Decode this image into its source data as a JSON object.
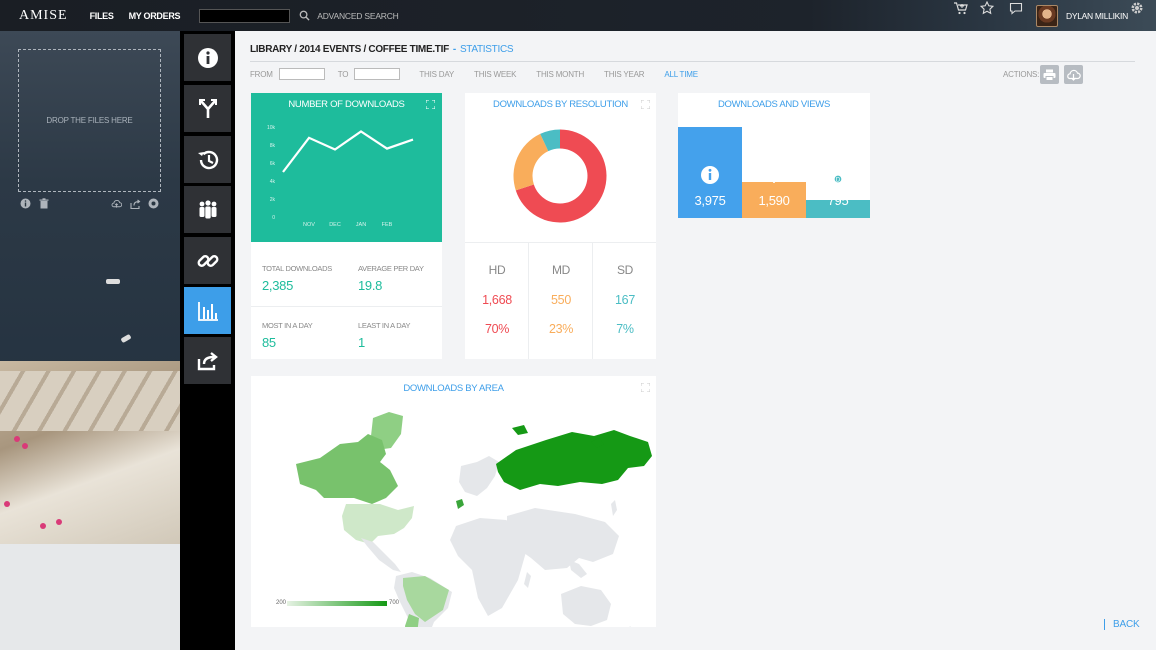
{
  "topbar": {
    "logo": "AMISE",
    "nav": [
      "FILES",
      "MY ORDERS"
    ],
    "search_value": "",
    "advanced_search": "ADVANCED SEARCH",
    "username": "DYLAN MILLIKIN"
  },
  "left": {
    "dropzone_text": "DROP THE FILES HERE"
  },
  "breadcrumb": {
    "path": "LIBRARY / 2014 EVENTS / COFFEE TIME.TIF",
    "separator": "-",
    "section": "STATISTICS"
  },
  "filters": {
    "from_label": "FROM",
    "to_label": "TO",
    "from_value": "",
    "to_value": "",
    "ranges": [
      "THIS DAY",
      "THIS WEEK",
      "THIS MONTH",
      "THIS YEAR",
      "ALL TIME"
    ],
    "active_range": "ALL TIME"
  },
  "actions_label": "ACTIONS:",
  "downloads_card": {
    "title": "NUMBER OF DOWNLOADS",
    "stats": [
      {
        "label": "TOTAL DOWNLOADS",
        "value": "2,385"
      },
      {
        "label": "AVERAGE PER DAY",
        "value": "19.8"
      },
      {
        "label": "MOST IN A DAY",
        "value": "85"
      },
      {
        "label": "LEAST IN A DAY",
        "value": "1"
      }
    ]
  },
  "resolution_card": {
    "title": "DOWNLOADS BY RESOLUTION",
    "columns": [
      {
        "label": "HD",
        "count": "1,668",
        "percent": "70%",
        "color": "#ef4b53"
      },
      {
        "label": "MD",
        "count": "550",
        "percent": "23%",
        "color": "#f9ad5b"
      },
      {
        "label": "SD",
        "count": "167",
        "percent": "7%",
        "color": "#4bbdc4"
      }
    ]
  },
  "views_card": {
    "title": "DOWNLOADS AND VIEWS",
    "bars": [
      {
        "value": "3,975",
        "icon": "info-icon",
        "color": "#44a1ec"
      },
      {
        "value": "1,590",
        "icon": "cloud-upload-icon",
        "color": "#f9ad5b"
      },
      {
        "value": "795",
        "icon": "cloud-download-icon",
        "color": "#4bbdc4"
      }
    ]
  },
  "area_card": {
    "title": "DOWNLOADS BY AREA",
    "legend_min": "200",
    "legend_max": "700"
  },
  "back_label": "BACK",
  "chart_data": [
    {
      "type": "line",
      "title": "NUMBER OF DOWNLOADS",
      "x": [
        "",
        "NOV",
        "DEC",
        "JAN",
        "FEB",
        ""
      ],
      "y": [
        5,
        8.8,
        7.5,
        9.5,
        7.6,
        8.6
      ],
      "yticks": [
        "0",
        "2k",
        "4k",
        "6k",
        "8k",
        "10k"
      ],
      "ylim": [
        0,
        10
      ],
      "color": "#ffffff"
    },
    {
      "type": "pie",
      "title": "DOWNLOADS BY RESOLUTION",
      "labels": [
        "HD",
        "MD",
        "SD"
      ],
      "values": [
        70,
        23,
        7
      ],
      "colors": [
        "#ef4b53",
        "#f9ad5b",
        "#4bbdc4"
      ]
    },
    {
      "type": "bar",
      "title": "DOWNLOADS AND VIEWS",
      "values": [
        3975,
        1590,
        795
      ],
      "colors": [
        "#44a1ec",
        "#f9ad5b",
        "#4bbdc4"
      ]
    }
  ]
}
